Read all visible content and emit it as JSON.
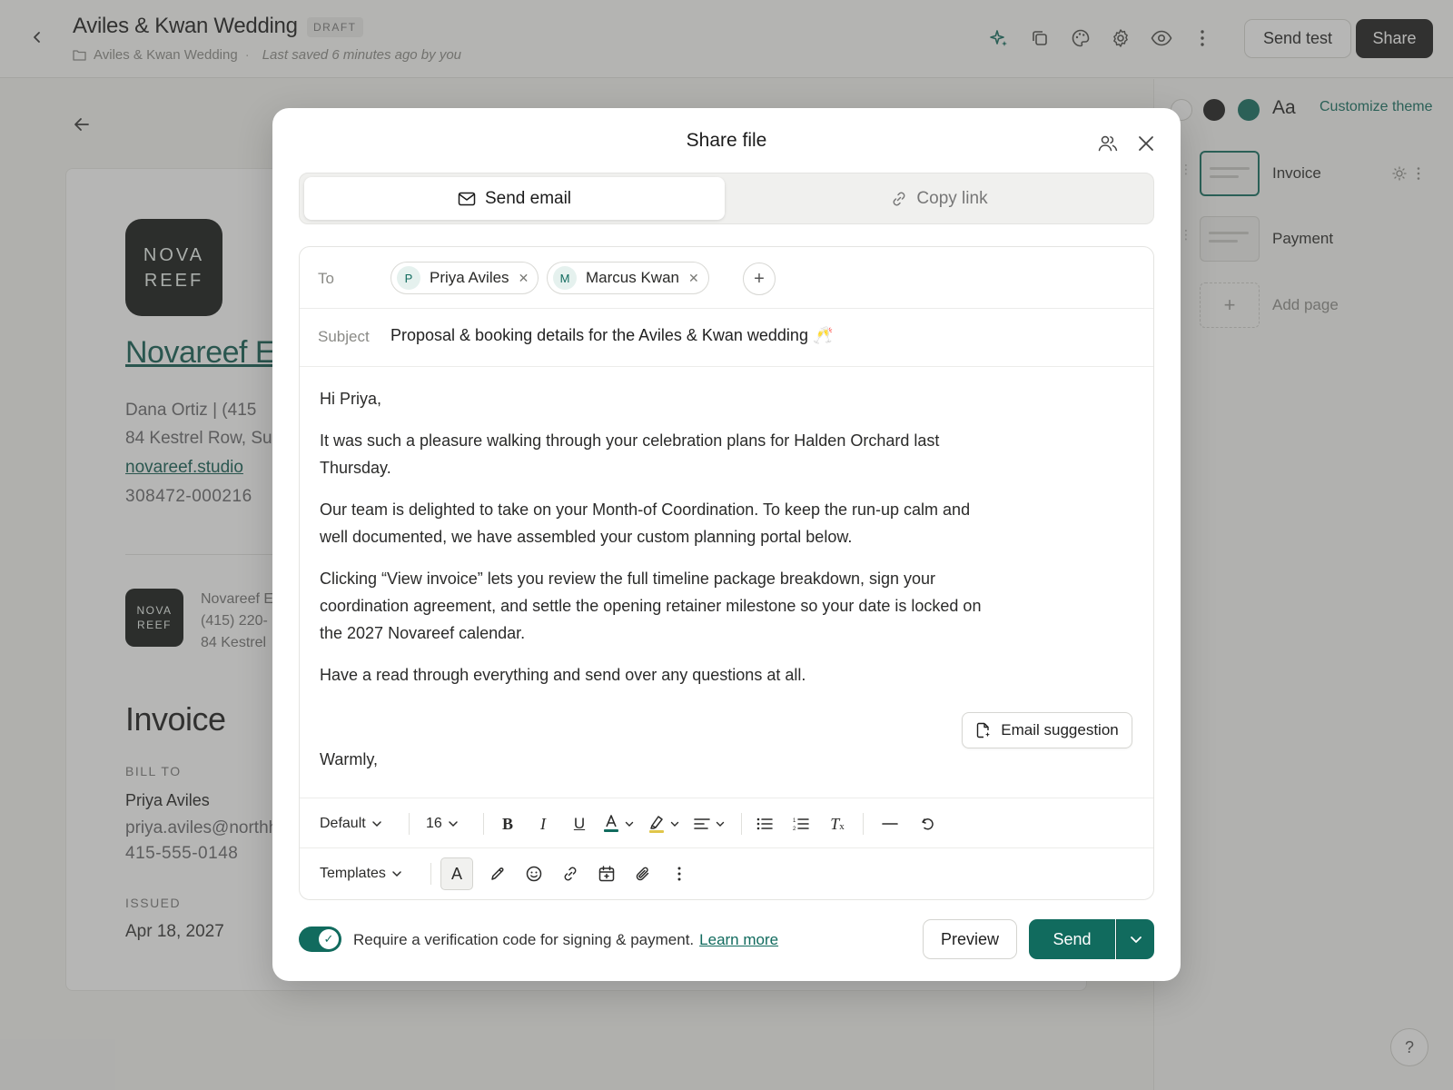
{
  "topbar": {
    "title": "Aviles & Kwan Wedding",
    "badge": "DRAFT",
    "breadcrumb_folder": "Aviles & Kwan Wedding",
    "last_saved": "Last saved 6 minutes ago by you",
    "send_test_label": "Send test",
    "share_label": "Share",
    "icons": [
      "sparkle-icon",
      "duplicate-icon",
      "palette-icon",
      "gear-icon",
      "eye-icon",
      "more-vertical-icon"
    ]
  },
  "theme": {
    "swatches": [
      "#ffffff",
      "#1b1b1b",
      "#116b5e"
    ],
    "font_label": "Aa",
    "customize_label": "Customize theme"
  },
  "pages": {
    "items": [
      {
        "label": "Invoice",
        "active": true
      },
      {
        "label": "Payment",
        "active": false
      }
    ],
    "add_label": "Add page"
  },
  "help_label": "?",
  "document": {
    "logo_line1": "NOVA",
    "logo_line2": "REEF",
    "company": "Novareef Ev",
    "contact_line": "Dana Ortiz  |  (415",
    "address_line": "84 Kestrel Row, Su",
    "website": "novareef.studio",
    "ref_number": "308472-000216",
    "small_company": "Novareef E",
    "small_phone": "(415) 220-",
    "small_address": "84 Kestrel",
    "invoice_heading": "Invoice",
    "bill_to_label": "BILL TO",
    "bill_name": "Priya Aviles",
    "bill_email": "priya.aviles@northh",
    "bill_phone": "415-555-0148",
    "issued_label": "ISSUED",
    "issued_date": "Apr 18, 2027"
  },
  "modal": {
    "title": "Share file",
    "tabs": {
      "send_email": "Send email",
      "copy_link": "Copy link"
    },
    "to_label": "To",
    "recipients": [
      {
        "initial": "P",
        "name": "Priya Aviles"
      },
      {
        "initial": "M",
        "name": "Marcus Kwan"
      }
    ],
    "subject_label": "Subject",
    "subject": "Proposal & booking details for the Aviles & Kwan wedding 🥂",
    "body": [
      "Hi Priya,",
      "It was such a pleasure walking through your celebration plans for Halden Orchard last Thursday.",
      "Our team is delighted to take on your Month-of Coordination. To keep the run-up calm and well documented, we have assembled your custom planning portal below.",
      "Clicking “View invoice” lets you review the full timeline package breakdown, sign your coordination agreement, and settle the opening retainer milestone so your date is locked on the 2027 Novareef calendar.",
      "Have a read through everything and send over any questions at all."
    ],
    "email_suggestion_label": "Email suggestion",
    "signoff": "Warmly,",
    "toolbar": {
      "style_value": "Default",
      "size_value": "16",
      "templates_label": "Templates",
      "text_color": "#116b5e",
      "highlight_color": "#e0c64a"
    },
    "verification_text": "Require a verification code for signing & payment.",
    "learn_more": "Learn more",
    "verification_enabled": true,
    "preview_label": "Preview",
    "send_label": "Send"
  }
}
